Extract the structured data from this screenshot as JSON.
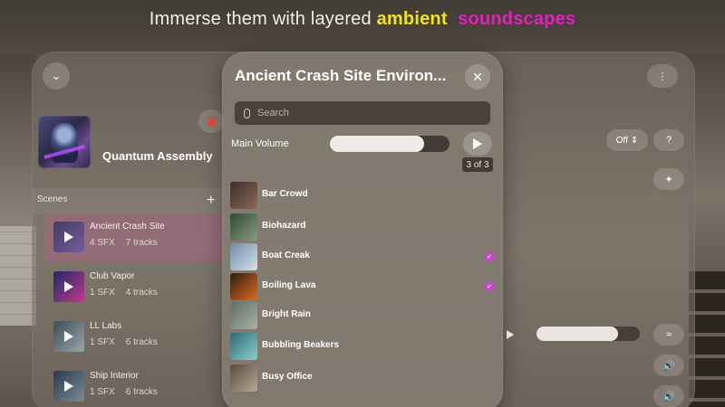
{
  "headline": {
    "prefix": "Immerse them with layered",
    "word1": "ambient",
    "word2": "soundscapes"
  },
  "sidebar": {
    "collection_title": "Quantum Assembly",
    "scenes_label": "Scenes",
    "scenes": [
      {
        "name": "Ancient Crash Site",
        "sfx": "4 SFX",
        "tracks": "7 tracks",
        "active": true,
        "colors": [
          "#3c3f66",
          "#7a5a9a"
        ]
      },
      {
        "name": "Club Vapor",
        "sfx": "1 SFX",
        "tracks": "4 tracks",
        "active": false,
        "colors": [
          "#1d2a66",
          "#c4388a"
        ]
      },
      {
        "name": "LL Labs",
        "sfx": "1 SFX",
        "tracks": "6 tracks",
        "active": false,
        "colors": [
          "#3a4d5a",
          "#9aa6a8"
        ]
      },
      {
        "name": "Ship Interior",
        "sfx": "1 SFX",
        "tracks": "6 tracks",
        "active": false,
        "colors": [
          "#2b3b4a",
          "#7b8a94"
        ]
      }
    ]
  },
  "right_panel": {
    "off_label": "Off",
    "volume_fraction": 0.79
  },
  "modal": {
    "title": "Ancient Crash Site Environ...",
    "search_placeholder": "Search",
    "volume_label": "Main Volume",
    "volume_fraction": 0.79,
    "count_label": "3 of 3",
    "sfx": [
      {
        "name": "Bar Crowd",
        "checked": false,
        "colors": [
          "#3b2e2a",
          "#8c6a55"
        ]
      },
      {
        "name": "Biohazard",
        "checked": false,
        "colors": [
          "#2f4a36",
          "#8a9a7c"
        ]
      },
      {
        "name": "Boat Creak",
        "checked": true,
        "colors": [
          "#6c8ba8",
          "#d8e2e8"
        ]
      },
      {
        "name": "Boiling Lava",
        "checked": true,
        "colors": [
          "#2e1e14",
          "#e26a1a"
        ]
      },
      {
        "name": "Bright Rain",
        "checked": false,
        "colors": [
          "#5f6e62",
          "#a7b2a8"
        ]
      },
      {
        "name": "Bubbling Beakers",
        "checked": false,
        "colors": [
          "#2f6a7a",
          "#8ad0c6"
        ]
      },
      {
        "name": "Busy Office",
        "checked": false,
        "colors": [
          "#5a4a3c",
          "#b8a896"
        ]
      }
    ]
  }
}
